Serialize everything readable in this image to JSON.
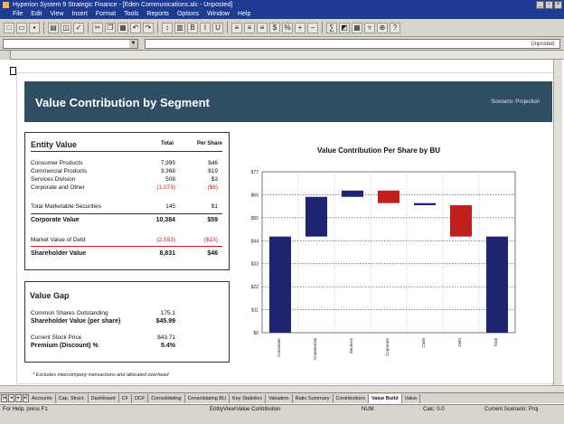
{
  "window": {
    "title": "Hyperion System 9 Strategic Finance - [Eden Communications.alc - Unposted]",
    "menus": [
      "File",
      "Edit",
      "View",
      "Insert",
      "Format",
      "Tools",
      "Reports",
      "Options",
      "Window",
      "Help"
    ],
    "toolbar_right": "Unposted"
  },
  "report": {
    "title": "Value Contribution by Segment",
    "scenario": "Scenario: Projection"
  },
  "entity_value": {
    "title": "Entity Value",
    "col_total": "Total",
    "col_per_share": "Per Share",
    "rows": [
      {
        "label": "Consumer Products",
        "total": "7,995",
        "per_share": "$46",
        "style": "normal"
      },
      {
        "label": "Commercial Products",
        "total": "3,368",
        "per_share": "$19",
        "style": "normal"
      },
      {
        "label": "Services Division",
        "total": "508",
        "per_share": "$3",
        "style": "normal"
      },
      {
        "label": "Corporate and Other",
        "total": "(1,073)",
        "per_share": "($6)",
        "style": "red"
      },
      {
        "label": "Total Marketable Securities",
        "total": "145",
        "per_share": "$1",
        "style": "normal"
      },
      {
        "label": "Corporate Value",
        "total": "10,384",
        "per_share": "$59",
        "style": "bold"
      },
      {
        "label": "Market Value of Debt",
        "total": "(2,553)",
        "per_share": "($15)",
        "style": "red"
      },
      {
        "label": "Shareholder Value",
        "total": "8,831",
        "per_share": "$46",
        "style": "bold"
      }
    ]
  },
  "value_gap": {
    "title": "Value Gap",
    "rows": [
      {
        "label": "Common Shares Outstanding",
        "value": "175.1",
        "style": "normal"
      },
      {
        "label": "Shareholder Value (per share)",
        "value": "$45.99",
        "style": "bold"
      },
      {
        "label": "Current Stock Price",
        "value": "$43.71",
        "style": "normal"
      },
      {
        "label": "Premium (Discount) %",
        "value": "5.4%",
        "style": "bold"
      }
    ]
  },
  "footnote": "* Excludes intercompany transactions and allocated overhead",
  "chart_data": {
    "type": "bar",
    "title": "Value Contribution Per Share by BU",
    "categories": [
      "Consumer",
      "Commercial",
      "Services",
      "Corporate",
      "Cash",
      "Debt",
      "Total"
    ],
    "bars": [
      {
        "start": 0,
        "end": 46,
        "color": "#1f2471"
      },
      {
        "start": 46,
        "end": 65,
        "color": "#1f2471"
      },
      {
        "start": 65,
        "end": 68,
        "color": "#1f2471"
      },
      {
        "start": 68,
        "end": 62,
        "color": "#c01f1f"
      },
      {
        "start": 62,
        "end": 61,
        "color": "#1f2471"
      },
      {
        "start": 61,
        "end": 46,
        "color": "#c01f1f"
      },
      {
        "start": 0,
        "end": 46,
        "color": "#1f2471"
      }
    ],
    "yticks": [
      "$0",
      "$11",
      "$22",
      "$33",
      "$44",
      "$55",
      "$66",
      "$77"
    ],
    "ylim": [
      0,
      77
    ],
    "grid": true
  },
  "sheet_tabs": [
    "Accounts",
    "Cap. Struct.",
    "Dashboard",
    "CF",
    "DCF",
    "Consolidating",
    "Consolidating BU",
    "Key Statistics",
    "Valuation",
    "Ratio Summary",
    "Contributions",
    "Value Build",
    "Value"
  ],
  "active_tab": "Value Build",
  "status": {
    "left": "For Help, press F1",
    "mid": "EntityView\\Value Contribution",
    "c3": "NUM",
    "c4": "Calc: 0.0",
    "c5": "Current Scenario: Proj"
  }
}
